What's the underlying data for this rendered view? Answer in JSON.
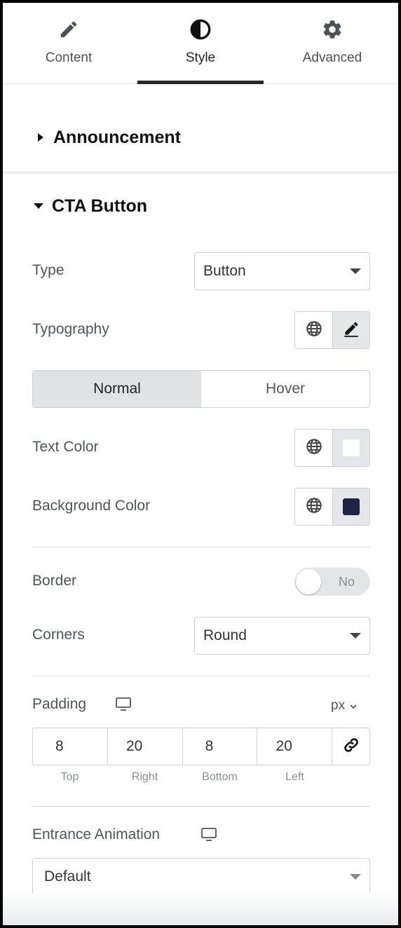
{
  "tabs": [
    {
      "label": "Content",
      "icon": "pencil-icon"
    },
    {
      "label": "Style",
      "icon": "contrast-icon"
    },
    {
      "label": "Advanced",
      "icon": "gear-icon"
    }
  ],
  "active_tab": "Style",
  "sections": {
    "announcement": {
      "title": "Announcement",
      "expanded": false
    },
    "cta_button": {
      "title": "CTA Button",
      "expanded": true
    }
  },
  "cta": {
    "type": {
      "label": "Type",
      "value": "Button"
    },
    "typography": {
      "label": "Typography"
    },
    "states": {
      "normal": "Normal",
      "hover": "Hover",
      "active": "Normal"
    },
    "text_color": {
      "label": "Text Color",
      "swatch": "#ffffff"
    },
    "background_color": {
      "label": "Background Color",
      "swatch": "#1e2347"
    },
    "border": {
      "label": "Border",
      "toggle_text": "No",
      "enabled": false
    },
    "corners": {
      "label": "Corners",
      "value": "Round"
    },
    "padding": {
      "label": "Padding",
      "unit": "px",
      "values": {
        "top": "8",
        "right": "20",
        "bottom": "8",
        "left": "20"
      },
      "labels": {
        "top": "Top",
        "right": "Right",
        "bottom": "Bottom",
        "left": "Left"
      }
    },
    "entrance_animation": {
      "label": "Entrance Animation",
      "value": "Default"
    }
  },
  "colors": {
    "accent_underline": "#26292c",
    "label_text": "#505458"
  }
}
